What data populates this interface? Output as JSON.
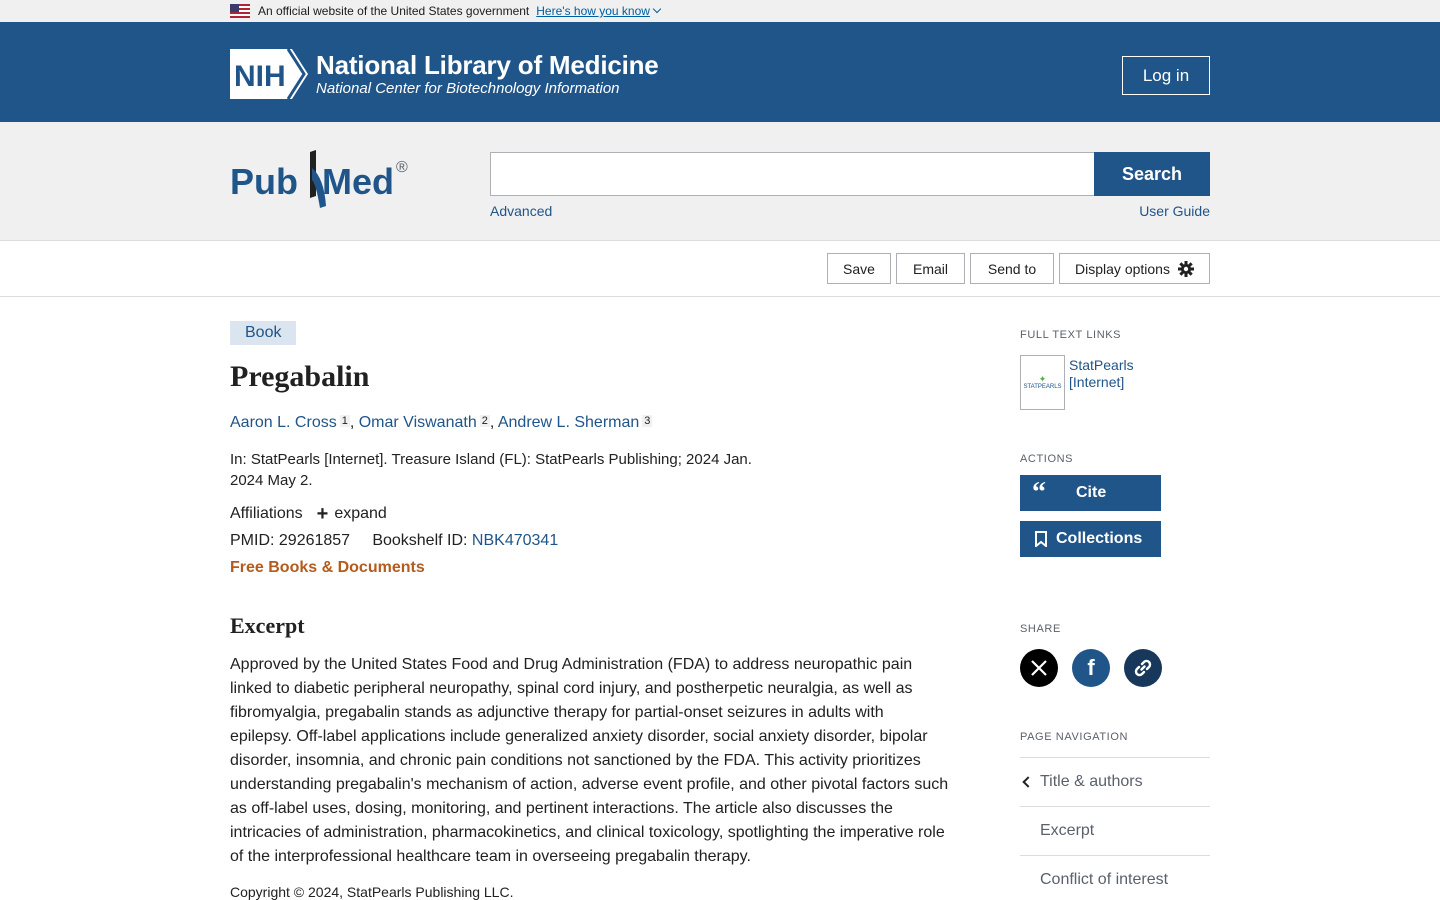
{
  "gov_banner": {
    "text": "An official website of the United States government",
    "link": "Here's how you know"
  },
  "nih_header": {
    "badge": "NIH",
    "title": "National Library of Medicine",
    "subtitle": "National Center for Biotechnology Information",
    "login": "Log in"
  },
  "search": {
    "logo_pub": "Pub",
    "logo_med": "Med",
    "logo_reg": "®",
    "input_value": "",
    "button": "Search",
    "advanced": "Advanced",
    "user_guide": "User Guide"
  },
  "toolbar": {
    "save": "Save",
    "email": "Email",
    "send_to": "Send to",
    "display_options": "Display options"
  },
  "article": {
    "type_badge": "Book",
    "title": "Pregabalin",
    "authors": [
      {
        "name": "Aaron L. Cross",
        "aff": "1"
      },
      {
        "name": "Omar Viswanath",
        "aff": "2"
      },
      {
        "name": "Andrew L. Sherman",
        "aff": "3"
      }
    ],
    "citation": "In: StatPearls [Internet]. Treasure Island (FL): StatPearls Publishing; 2024 Jan.",
    "citation_date": "2024 May 2.",
    "affiliations_label": "Affiliations",
    "expand_label": "expand",
    "pmid_label": "PMID: 29261857",
    "bookshelf_label": "Bookshelf ID:",
    "bookshelf_id": "NBK470341",
    "free_books": "Free Books & Documents",
    "excerpt_heading": "Excerpt",
    "excerpt_text": "Approved by the United States Food and Drug Administration (FDA) to address neuropathic pain linked to diabetic peripheral neuropathy, spinal cord injury, and postherpetic neuralgia, as well as fibromyalgia, pregabalin stands as adjunctive therapy for partial-onset seizures in adults with epilepsy. Off-label applications include generalized anxiety disorder, social anxiety disorder, bipolar disorder, insomnia, and chronic pain conditions not sanctioned by the FDA. This activity prioritizes understanding pregabalin's mechanism of action, adverse event profile, and other pivotal factors such as off-label uses, dosing, monitoring, and pertinent interactions. The article also discusses the intricacies of administration, pharmacokinetics, and clinical toxicology, spotlighting the imperative role of the interprofessional healthcare team in overseeing pregabalin therapy.",
    "copyright": "Copyright © 2024, StatPearls Publishing LLC."
  },
  "sidebar": {
    "full_text_heading": "FULL TEXT LINKS",
    "full_text_thumb": "STATPEARLS",
    "full_text_link_1": "StatPearls",
    "full_text_link_2": "[Internet]",
    "actions_heading": "ACTIONS",
    "cite": "Cite",
    "collections": "Collections",
    "share_heading": "SHARE",
    "page_nav_heading": "PAGE NAVIGATION",
    "nav_items": [
      "Title & authors",
      "Excerpt",
      "Conflict of interest"
    ]
  },
  "colors": {
    "nih_blue": "#20558a",
    "link": "#20558a",
    "free_books": "#b55b1c",
    "x_black": "#000000",
    "facebook": "#20558a",
    "link_share": "#18385b"
  }
}
